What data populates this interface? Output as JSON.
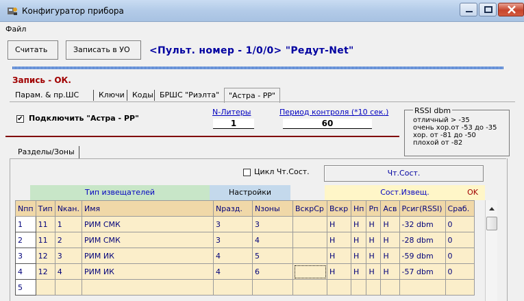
{
  "window": {
    "title": "Конфигуратор прибора"
  },
  "menu": {
    "file": "Файл"
  },
  "toolbar": {
    "read": "Считать",
    "write": "Записать в УО"
  },
  "device": {
    "title": "<Пульт. номер - 1/0/0> \"Редут-Net\""
  },
  "status": "Запись - ОК.",
  "tabs": [
    "Парам. & пр.ШС",
    "Ключи",
    "Коды",
    "БРШС \"Риэлта\"",
    "\"Астра - РР\""
  ],
  "astra": {
    "connect_label": "Подключить  \"Астра - РР\"",
    "connect_checked": true,
    "n_liters_label": "N-Литеры",
    "n_liters_value": "1",
    "period_label": "Период контроля (*10 сек.)",
    "period_value": "60"
  },
  "rssi": {
    "title": "RSSI  dbm",
    "lines": [
      "отличный > -35",
      "очень хор.от -53 до -35",
      "хор. от -81 до -50",
      "плохой от -82"
    ]
  },
  "subtab": "Разделы/Зоны",
  "cycle": {
    "label": "Цикл Чт.Сост.",
    "checked": false,
    "button": "Чт.Сост."
  },
  "groups": {
    "types": "Тип извещателей",
    "settings": "Настройки",
    "state": "Сост.Извещ.",
    "state_ok": "OK"
  },
  "colors": {
    "types_bg": "#c8e6c8",
    "settings_bg": "#c4d9ec",
    "state_bg": "#fff6c8",
    "grid_bg": "#fbeeca",
    "text": "#00007a"
  },
  "table": {
    "columns": [
      "Nпп",
      "Тип",
      "Nкан.",
      "Имя",
      "Nразд.",
      "Nзоны",
      "ВскрСр",
      "Вскр",
      "Нп",
      "Рп",
      "Асв",
      "Рсиг(RSSI)",
      "Сраб."
    ],
    "rows": [
      [
        "1",
        "11",
        "1",
        "РИМ СМК",
        "3",
        "3",
        "",
        "Н",
        "Н",
        "Н",
        "Н",
        "-32 dbm",
        "0"
      ],
      [
        "2",
        "11",
        "2",
        "РИМ СМК",
        "3",
        "4",
        "",
        "Н",
        "Н",
        "Н",
        "Н",
        "-28 dbm",
        "0"
      ],
      [
        "3",
        "12",
        "3",
        "РИМ ИК",
        "4",
        "5",
        "",
        "Н",
        "Н",
        "Н",
        "Н",
        "-59 dbm",
        "0"
      ],
      [
        "4",
        "12",
        "4",
        "РИМ ИК",
        "4",
        "6",
        "",
        "Н",
        "Н",
        "Н",
        "Н",
        "-57 dbm",
        "0"
      ],
      [
        "5",
        "",
        "",
        "",
        "",
        "",
        "",
        "",
        "",
        "",
        "",
        "",
        ""
      ]
    ]
  }
}
